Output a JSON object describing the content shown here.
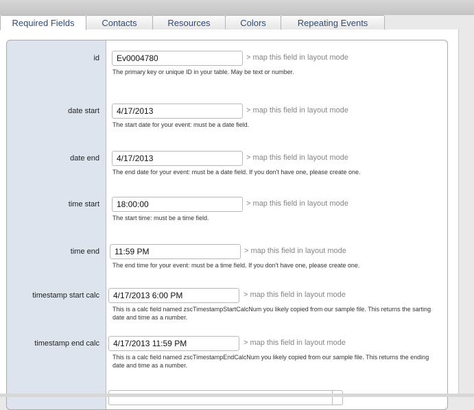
{
  "tabs": [
    {
      "label": "Required Fields"
    },
    {
      "label": "Contacts"
    },
    {
      "label": "Resources"
    },
    {
      "label": "Colors"
    },
    {
      "label": "Repeating Events"
    }
  ],
  "map_link": "> map this field in layout mode",
  "fields": [
    {
      "label": "id",
      "value": "Ev0004780",
      "help": "The primary key or unique ID in your table. May be text or number."
    },
    {
      "label": "date start",
      "value": "4/17/2013",
      "help": "The start date for your event: must be a date field."
    },
    {
      "label": "date end",
      "value": "4/17/2013",
      "help": "The end date for your event: must be a date field. If you don't have one, please create one."
    },
    {
      "label": "time start",
      "value": "18:00:00",
      "help": "The start time: must be a time field."
    },
    {
      "label": "time end",
      "value": "11:59 PM",
      "help": "The end time for your event: must be a time field. If you don't have one, please create one."
    },
    {
      "label": "timestamp start calc",
      "value": "4/17/2013 6:00 PM",
      "help": "This is a calc field named zscTimestampStartCalcNum you likely copied from our sample file. This returns the sarting date and time as a number."
    },
    {
      "label": "timestamp end calc",
      "value": "4/17/2013 11:59 PM",
      "help": "This is a calc field named zscTimestampEndCalcNum you likely copied from our sample file. This returns the ending date and time as a number."
    }
  ]
}
